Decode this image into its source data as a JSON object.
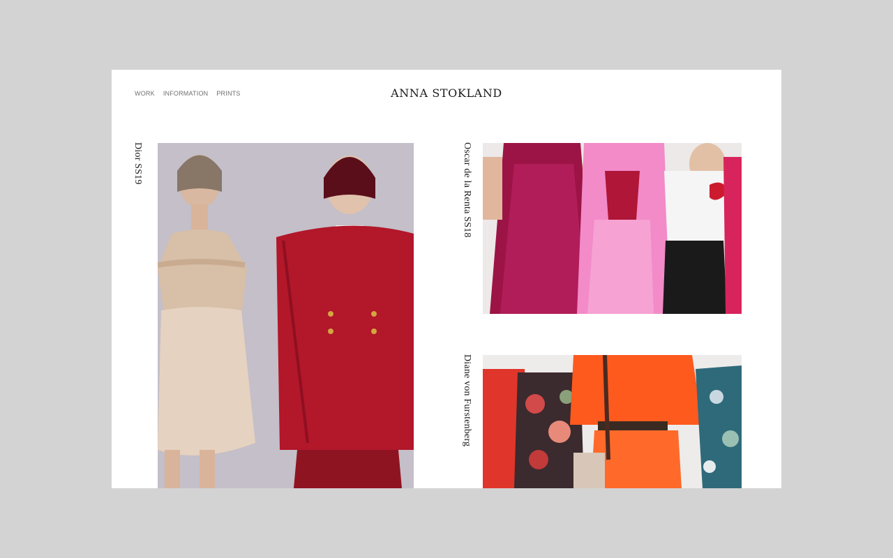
{
  "nav": {
    "items": [
      {
        "label": "WORK"
      },
      {
        "label": "INFORMATION"
      },
      {
        "label": "PRINTS"
      }
    ]
  },
  "site": {
    "title": "ANNA STOKLAND"
  },
  "projects": [
    {
      "title": "Dior SS19",
      "image_alt": "Dior SS19"
    },
    {
      "title": "Oscar de la Renta SS18",
      "image_alt": "Oscar de la Renta SS18"
    },
    {
      "title": "Diane von Furstenberg",
      "image_alt": "Diane von Furstenberg"
    }
  ],
  "colors": {
    "backdrop": "#d3d3d3",
    "page": "#ffffff",
    "text": "#1a1a1a",
    "nav": "#6f6f6f"
  }
}
